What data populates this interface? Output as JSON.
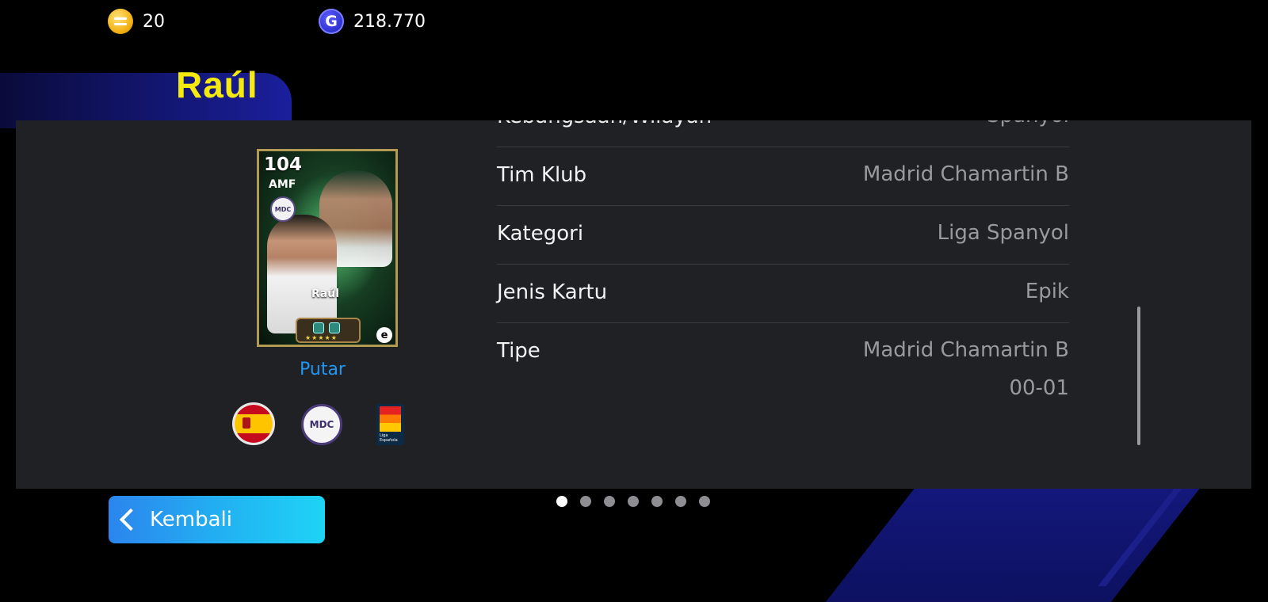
{
  "currency": {
    "coins_icon": "efootball-coin-icon",
    "coins_value": "20",
    "gp_icon": "gp-icon",
    "gp_icon_glyph": "G",
    "gp_value": "218.770"
  },
  "player": {
    "name": "Raúl"
  },
  "card": {
    "rating": "104",
    "position": "AMF",
    "club_initials": "MDC",
    "name": "Raúl",
    "stars": "★★★★★",
    "brand_glyph": "e"
  },
  "play_label": "Putar",
  "badges": {
    "nation": "Spain flag",
    "club": "MDC",
    "league": "Liga Española"
  },
  "info_rows": [
    {
      "label": "Kebangsaan/Wilayah",
      "value": "Spanyol"
    },
    {
      "label": "Tim Klub",
      "value": "Madrid Chamartin B"
    },
    {
      "label": "Kategori",
      "value": "Liga Spanyol"
    },
    {
      "label": "Jenis Kartu",
      "value": "Epik"
    },
    {
      "label": "Tipe",
      "value": "Madrid Chamartin B",
      "value2": "00-01"
    }
  ],
  "back_button": {
    "label": "Kembali"
  },
  "pagination": {
    "total": 7,
    "active_index": 0
  },
  "colors": {
    "title_yellow": "#f4ea10",
    "link_blue": "#2196f3",
    "panel_bg": "#202125",
    "value_gray": "#9a9a9e"
  }
}
